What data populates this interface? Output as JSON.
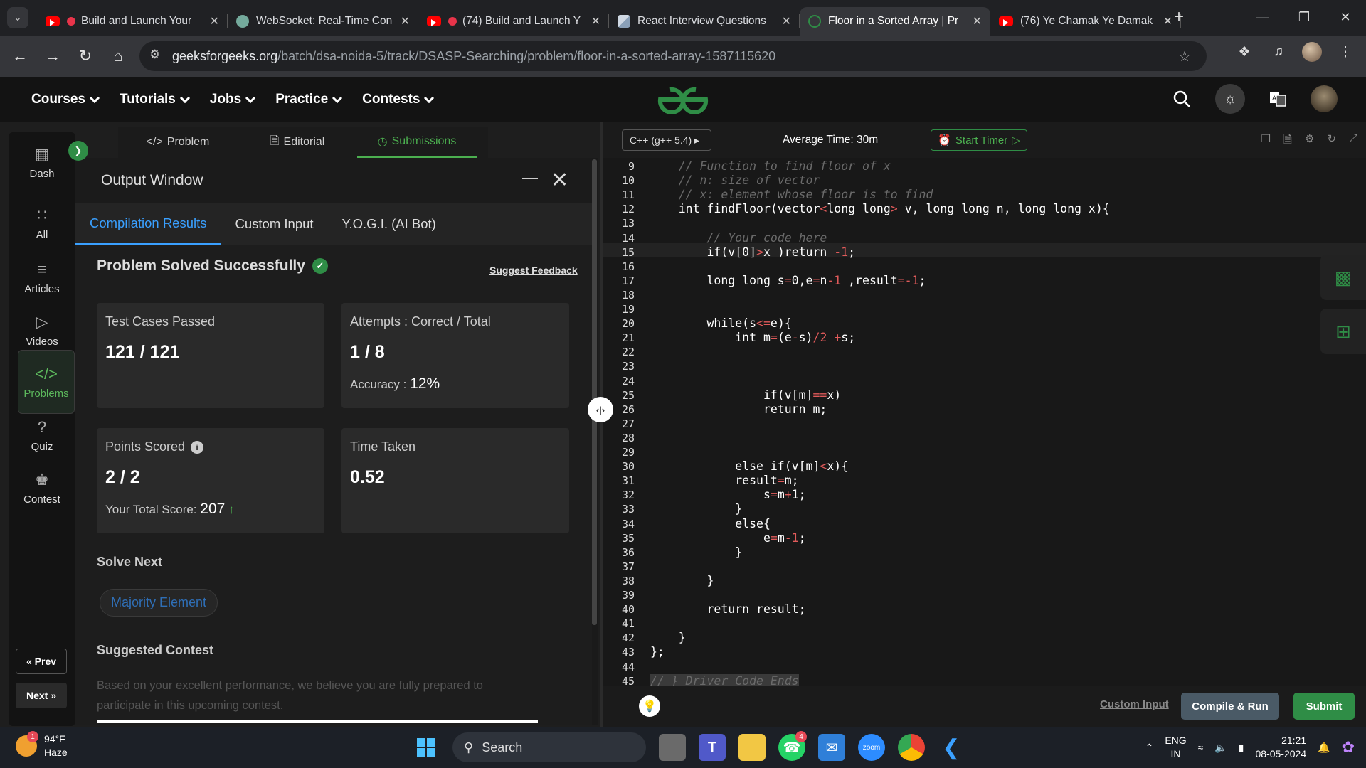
{
  "browser": {
    "tabs": [
      {
        "title": "Build and Launch Your",
        "icon": "youtube-icon",
        "recording": true
      },
      {
        "title": "WebSocket: Real-Time Con",
        "icon": "openai-icon"
      },
      {
        "title": "(74)  Build and Launch Y",
        "icon": "youtube-icon",
        "recording": true
      },
      {
        "title": "React Interview Questions",
        "icon": "scaler-icon"
      },
      {
        "title": "Floor in a Sorted Array | Pr",
        "icon": "gfg-icon",
        "active": true
      },
      {
        "title": "(76) Ye Chamak Ye Damak",
        "icon": "youtube-icon"
      }
    ],
    "url_domain": "geeksforgeeks.org",
    "url_path": "/batch/dsa-noida-5/track/DSASP-Searching/problem/floor-in-a-sorted-array-1587115620"
  },
  "gfg_nav": {
    "links": [
      "Courses",
      "Tutorials",
      "Jobs",
      "Practice",
      "Contests"
    ]
  },
  "sidebar": {
    "items": [
      {
        "label": "Dash",
        "icon": "dashboard-icon"
      },
      {
        "label": "All",
        "icon": "grid-icon"
      },
      {
        "label": "Articles",
        "icon": "book-icon"
      },
      {
        "label": "Videos",
        "icon": "video-icon"
      },
      {
        "label": "Problems",
        "icon": "code-icon",
        "active": true
      },
      {
        "label": "Quiz",
        "icon": "question-icon"
      },
      {
        "label": "Contest",
        "icon": "trophy-icon"
      }
    ],
    "prev": "Prev",
    "next": "Next"
  },
  "problem_tabs": [
    "Problem",
    "Editorial",
    "Submissions"
  ],
  "output": {
    "title": "Output Window",
    "tabs": [
      "Compilation Results",
      "Custom Input",
      "Y.O.G.I. (AI Bot)"
    ],
    "status": "Problem Solved Successfully",
    "suggest_feedback": "Suggest Feedback",
    "test_cases_label": "Test Cases Passed",
    "test_cases_value": "121 / 121",
    "attempts_label": "Attempts : Correct / Total",
    "attempts_value": "1 / 8",
    "accuracy_label": "Accuracy :",
    "accuracy_value": "12%",
    "points_label": "Points Scored",
    "points_value": "2 / 2",
    "total_score_label": "Your Total Score:",
    "total_score_value": "207",
    "time_label": "Time Taken",
    "time_value": "0.52",
    "solve_next_label": "Solve Next",
    "solve_next_item": "Majority Element",
    "suggested_contest_label": "Suggested Contest",
    "suggested_contest_text": "Based on your excellent performance, we believe you are fully prepared to participate in this upcoming contest."
  },
  "editor": {
    "language": "C++ (g++ 5.4)",
    "average_time": "Average Time: 30m",
    "start_timer": "Start Timer",
    "custom_input": "Custom Input",
    "compile_run": "Compile & Run",
    "submit": "Submit",
    "lines": [
      {
        "n": "9",
        "text": "    // Function to find floor of x"
      },
      {
        "n": "10",
        "text": "    // n: size of vector"
      },
      {
        "n": "11",
        "text": "    // x: element whose floor is to find"
      },
      {
        "n": "12",
        "text": "    int findFloor(vector<long long> v, long long n, long long x){"
      },
      {
        "n": "13",
        "text": ""
      },
      {
        "n": "14",
        "text": "        // Your code here"
      },
      {
        "n": "15",
        "text": "        if(v[0]>x )return -1;"
      },
      {
        "n": "16",
        "text": ""
      },
      {
        "n": "17",
        "text": "        long long s=0,e=n-1 ,result=-1;"
      },
      {
        "n": "18",
        "text": ""
      },
      {
        "n": "19",
        "text": ""
      },
      {
        "n": "20",
        "text": "        while(s<=e){"
      },
      {
        "n": "21",
        "text": "            int m=(e-s)/2 +s;"
      },
      {
        "n": "22",
        "text": ""
      },
      {
        "n": "23",
        "text": ""
      },
      {
        "n": "24",
        "text": ""
      },
      {
        "n": "25",
        "text": "                if(v[m]==x)"
      },
      {
        "n": "26",
        "text": "                return m;"
      },
      {
        "n": "27",
        "text": ""
      },
      {
        "n": "28",
        "text": ""
      },
      {
        "n": "29",
        "text": ""
      },
      {
        "n": "30",
        "text": "            else if(v[m]<x){"
      },
      {
        "n": "31",
        "text": "            result=m;"
      },
      {
        "n": "32",
        "text": "                s=m+1;"
      },
      {
        "n": "33",
        "text": "            }"
      },
      {
        "n": "34",
        "text": "            else{"
      },
      {
        "n": "35",
        "text": "                e=m-1;"
      },
      {
        "n": "36",
        "text": "            }"
      },
      {
        "n": "37",
        "text": ""
      },
      {
        "n": "38",
        "text": "        }"
      },
      {
        "n": "39",
        "text": ""
      },
      {
        "n": "40",
        "text": "        return result;"
      },
      {
        "n": "41",
        "text": ""
      },
      {
        "n": "42",
        "text": "    }"
      },
      {
        "n": "43",
        "text": "};"
      },
      {
        "n": "44",
        "text": ""
      },
      {
        "n": "45",
        "text": "// } Driver Code Ends"
      }
    ]
  },
  "taskbar": {
    "temperature": "94°F",
    "weather": "Haze",
    "weather_badge": "1",
    "search": "Search",
    "whatsapp_badge": "4",
    "lang1": "ENG",
    "lang2": "IN",
    "time": "21:21",
    "date": "08-05-2024"
  }
}
